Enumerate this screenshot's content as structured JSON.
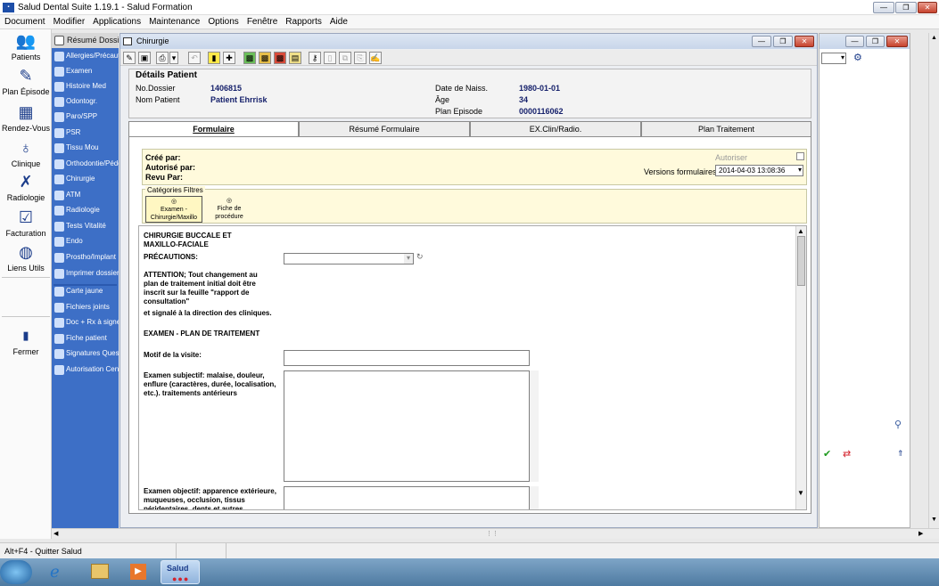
{
  "window": {
    "title": "Salud Dental Suite 1.19.1 - Salud Formation",
    "logo": "Salud"
  },
  "menu": [
    "Document",
    "Modifier",
    "Applications",
    "Maintenance",
    "Options",
    "Fenêtre",
    "Rapports",
    "Aide"
  ],
  "left_bar": [
    {
      "label": "Patients",
      "icon": "people-icon"
    },
    {
      "label": "Plan Épisode",
      "icon": "plan-episode-icon"
    },
    {
      "label": "Rendez-Vous",
      "icon": "calendar-icon"
    },
    {
      "label": "Clinique",
      "icon": "tooth-icon"
    },
    {
      "label": "Radiologie",
      "icon": "xray-icon"
    },
    {
      "label": "Facturation",
      "icon": "invoice-icon"
    },
    {
      "label": "Liens Utils",
      "icon": "globe-icon"
    }
  ],
  "left_bar_close": "Fermer",
  "nav": {
    "header": "Résumé Dossier",
    "items": [
      "Allergies/Précautions",
      "Examen",
      "Histoire Med",
      "Odontogr.",
      "Paro/SPP",
      "PSR",
      "Tissu Mou",
      "Orthodontie/Pédo",
      "Chirurgie",
      "ATM",
      "Radiologie",
      "Tests Vitalité",
      "Endo",
      "Prostho/Implant",
      "Imprimer dossier"
    ],
    "items2": [
      "Carte jaune",
      "Fichiers joints",
      "Doc + Rx à signer",
      "Fiche patient",
      "Signatures Questionnaire",
      "Autorisation Centre"
    ]
  },
  "child": {
    "title": "Chirurgie"
  },
  "details": {
    "title": "Détails Patient",
    "no_dossier_label": "No.Dossier",
    "no_dossier": "1406815",
    "nom_label": "Nom Patient",
    "nom": "Patient Ehrrisk",
    "naiss_label": "Date de Naiss.",
    "naiss": "1980-01-01",
    "age_label": "Âge",
    "age": "34",
    "plan_label": "Plan Episode",
    "plan": "0000116062"
  },
  "tabs": [
    "Formulaire",
    "Résumé Formulaire",
    "EX.Clin/Radio.",
    "Plan Traitement"
  ],
  "form": {
    "cree": "Créé par:",
    "autorise": "Autorisé par:",
    "revu": "Revu Par:",
    "autoriser": "Autoriser",
    "versions_label": "Versions formulaires:",
    "version": "2014-04-03 13:08:36",
    "categories": "Catégories Filtres",
    "cat1": "Examen - Chirurgie/Maxillo",
    "cat2": "Fiche de procédure",
    "heading": "CHIRURGIE BUCCALE ET MAXILLO-FACIALE",
    "precautions": "PRÉCAUTIONS:",
    "attention": "ATTENTION; Tout changement au plan de traitement initial doit être inscrit sur la feuille \"rapport de consultation\"",
    "signale": "et signalé à la direction des cliniques.",
    "examen_plan": "EXAMEN - PLAN DE TRAITEMENT",
    "motif": "Motif de la visite:",
    "subjectif": "Examen subjectif: malaise, douleur, enflure (caractères, durée, localisation, etc.). traitements antérieurs",
    "objectif": "Examen objectif:  apparence extérieure, muqueuses, occlusion, tissus péridentaires, dents et autres"
  },
  "status": {
    "text": "Alt+F4 - Quitter Salud"
  },
  "taskbar": {
    "active": "Salud"
  }
}
